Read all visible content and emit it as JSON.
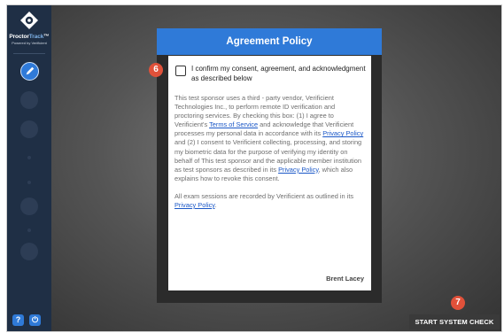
{
  "app": {
    "brand_main": "Proctor",
    "brand_highlight": "Track",
    "brand_tm": "™",
    "powered_by": "Powered by Verificient"
  },
  "sidebar": {
    "steps": [
      {
        "name": "pencil-icon",
        "active": true
      },
      {
        "name": "step-icon-2",
        "active": false
      },
      {
        "name": "step-icon-3",
        "active": false
      },
      {
        "name": "step-dot-4",
        "active": false
      },
      {
        "name": "step-dot-5",
        "active": false
      },
      {
        "name": "step-icon-6",
        "active": false
      },
      {
        "name": "step-dot-7",
        "active": false
      },
      {
        "name": "step-icon-8",
        "active": false
      }
    ],
    "bottom": {
      "help_label": "?",
      "power_label": "⏻"
    }
  },
  "modal": {
    "title": "Agreement Policy",
    "consent_label": "I confirm my consent, agreement, and acknowledgment as described below",
    "paragraph1": {
      "t1": "This test sponsor uses a third - party vendor, Verificient Technologies Inc., to perform remote ID verification and proctoring services. By checking this box: (1) I agree to Verificient's ",
      "link1": "Terms of Service",
      "t2": " and acknowledge that Verificient processes my personal data in accordance with its ",
      "link2": "Privacy Policy",
      "t3": " and (2) I consent to Verificient collecting, processing, and storing my biometric data for the purpose of verifying my identity on behalf of This test sponsor and the applicable member institution as test sponsors as described in its ",
      "link3": "Privacy Policy",
      "t4": ", which also explains how to revoke this consent."
    },
    "paragraph2": {
      "t1": "All exam sessions are recorded by Verificient as outlined in its ",
      "link1": "Privacy Policy",
      "t2": "."
    },
    "signer": "Brent Lacey"
  },
  "annotations": {
    "badge_consent": "6",
    "badge_start": "7"
  },
  "actions": {
    "start_label": "START SYSTEM CHECK"
  },
  "colors": {
    "accent": "#2f7ad8",
    "sidebar": "#1f2f45",
    "badge": "#e0513a",
    "link": "#1a57c7"
  }
}
